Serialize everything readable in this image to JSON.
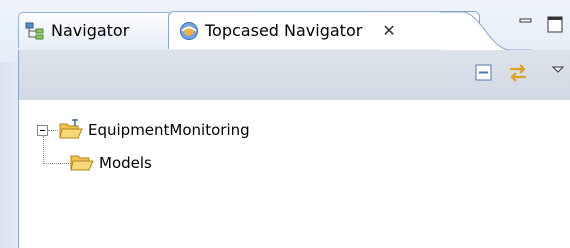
{
  "tabs": [
    {
      "label": "Navigator",
      "icon": "navigator-icon",
      "active": false
    },
    {
      "label": "Topcased Navigator",
      "icon": "topcased-icon",
      "active": true
    }
  ],
  "close_glyph": "✕",
  "window_controls": {
    "minimize": "minimize-icon",
    "maximize": "maximize-icon"
  },
  "toolbar": {
    "collapse_all_icon": "collapse-all-icon",
    "link_editor_icon": "link-with-editor-icon",
    "view_menu_icon": "view-menu-icon"
  },
  "tree": {
    "root": {
      "label": "EquipmentMonitoring",
      "icon": "project-folder-icon",
      "expanded": true
    },
    "children": [
      {
        "label": "Models",
        "icon": "folder-icon"
      }
    ]
  },
  "colors": {
    "tab_border": "#8aa6cc",
    "folder": "#f2c14e",
    "toolbar_bg": "#d6dde8"
  }
}
